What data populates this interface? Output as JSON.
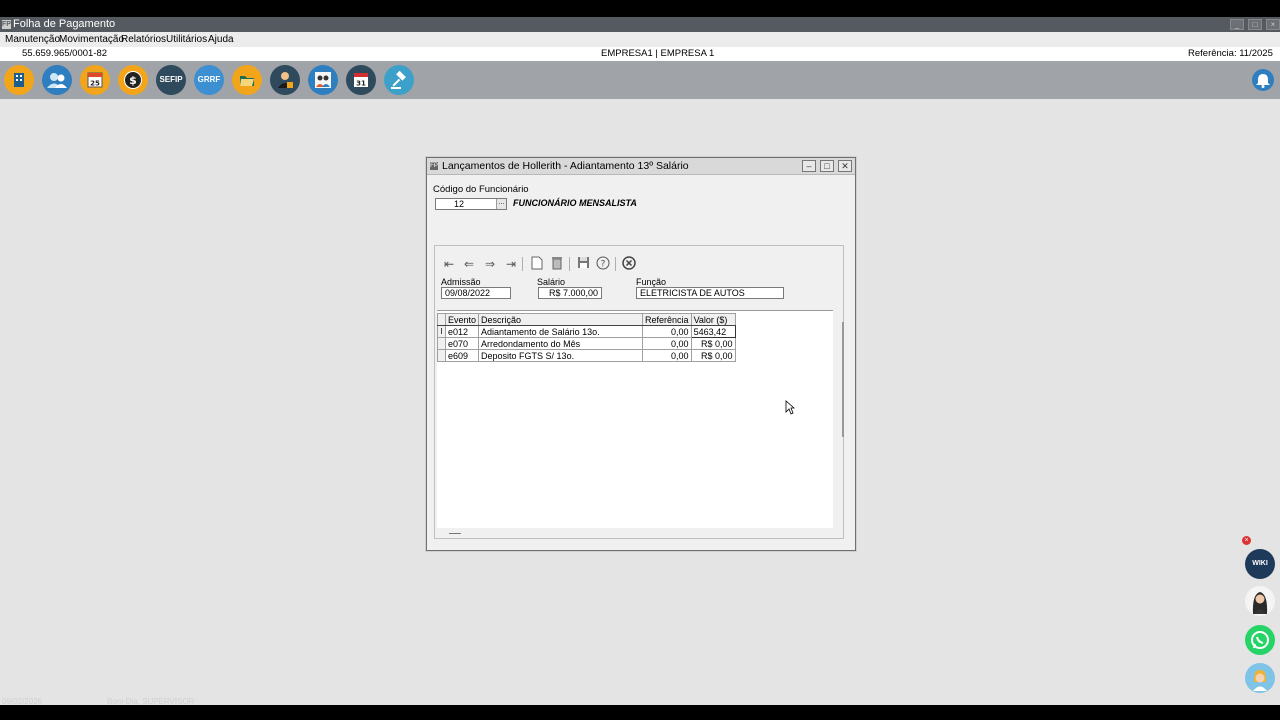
{
  "app": {
    "title": "Folha de Pagamento",
    "window_buttons": [
      "_",
      "□",
      "×"
    ]
  },
  "menu": [
    "Manutenção",
    "Movimentação",
    "Relatórios",
    "Utilitários",
    "Ajuda"
  ],
  "info": {
    "cnpj": "55.659.965/0001-82",
    "empresa": "EMPRESA1 | EMPRESA 1",
    "referencia": "Referência: 11/2025"
  },
  "toolbar": {
    "buttons": [
      {
        "icon": "building-icon",
        "label": "",
        "color": "#f2a51a"
      },
      {
        "icon": "users-icon",
        "label": "",
        "color": "#2f7fc0"
      },
      {
        "icon": "calendar-25-icon",
        "label": "25",
        "color": "#f2a51a"
      },
      {
        "icon": "dollar-icon",
        "label": "$",
        "color": "#f2a51a"
      },
      {
        "icon": "sefip-icon",
        "label": "SEFIP",
        "color": "#2e4a5c"
      },
      {
        "icon": "grrf-icon",
        "label": "GRRF",
        "color": "#3c8fd0"
      },
      {
        "icon": "folder-icon",
        "label": "",
        "color": "#f2a51a"
      },
      {
        "icon": "employee-icon",
        "label": "",
        "color": "#2e4a5c"
      },
      {
        "icon": "team-icon",
        "label": "",
        "color": "#2f7fc0"
      },
      {
        "icon": "calendar-31-icon",
        "label": "31",
        "color": "#2e4a5c"
      },
      {
        "icon": "gavel-icon",
        "label": "",
        "color": "#3ca0c8"
      }
    ],
    "notification_icon": "bell-icon"
  },
  "dialog": {
    "title": "Lançamentos de Hollerith - Adiantamento 13º Salário",
    "codigo_label": "Código do Funcionário",
    "codigo_value": "12",
    "funcionario_tipo": "FUNCIONÁRIO MENSALISTA",
    "admissao_label": "Admissão",
    "admissao_value": "09/08/2022",
    "salario_label": "Salário",
    "salario_value": "R$ 7.000,00",
    "funcao_label": "Função",
    "funcao_value": "ELETRICISTA DE AUTOS",
    "nav_icons": [
      "first-record-icon",
      "prev-record-icon",
      "next-record-icon",
      "last-record-icon",
      "new-document-icon",
      "delete-icon",
      "save-icon",
      "help-icon",
      "close-icon"
    ],
    "grid": {
      "columns": [
        "Evento",
        "Descrição",
        "Referência",
        "Valor ($)"
      ],
      "rows": [
        {
          "indicator": "I",
          "evento": "e012",
          "descricao": "Adiantamento de Salário 13o.",
          "referencia": "0,00",
          "valor": "5463,42"
        },
        {
          "indicator": "",
          "evento": "e070",
          "descricao": "Arredondamento do Mês",
          "referencia": "0,00",
          "valor": "R$ 0,00"
        },
        {
          "indicator": "",
          "evento": "e609",
          "descricao": "Deposito FGTS S/ 13o.",
          "referencia": "0,00",
          "valor": "R$ 0,00"
        }
      ]
    }
  },
  "status": {
    "date": "09/02/2026",
    "user": "Bom Dia, SUPERVISOR"
  },
  "side_widgets": {
    "wiki_label": "WIKI"
  }
}
